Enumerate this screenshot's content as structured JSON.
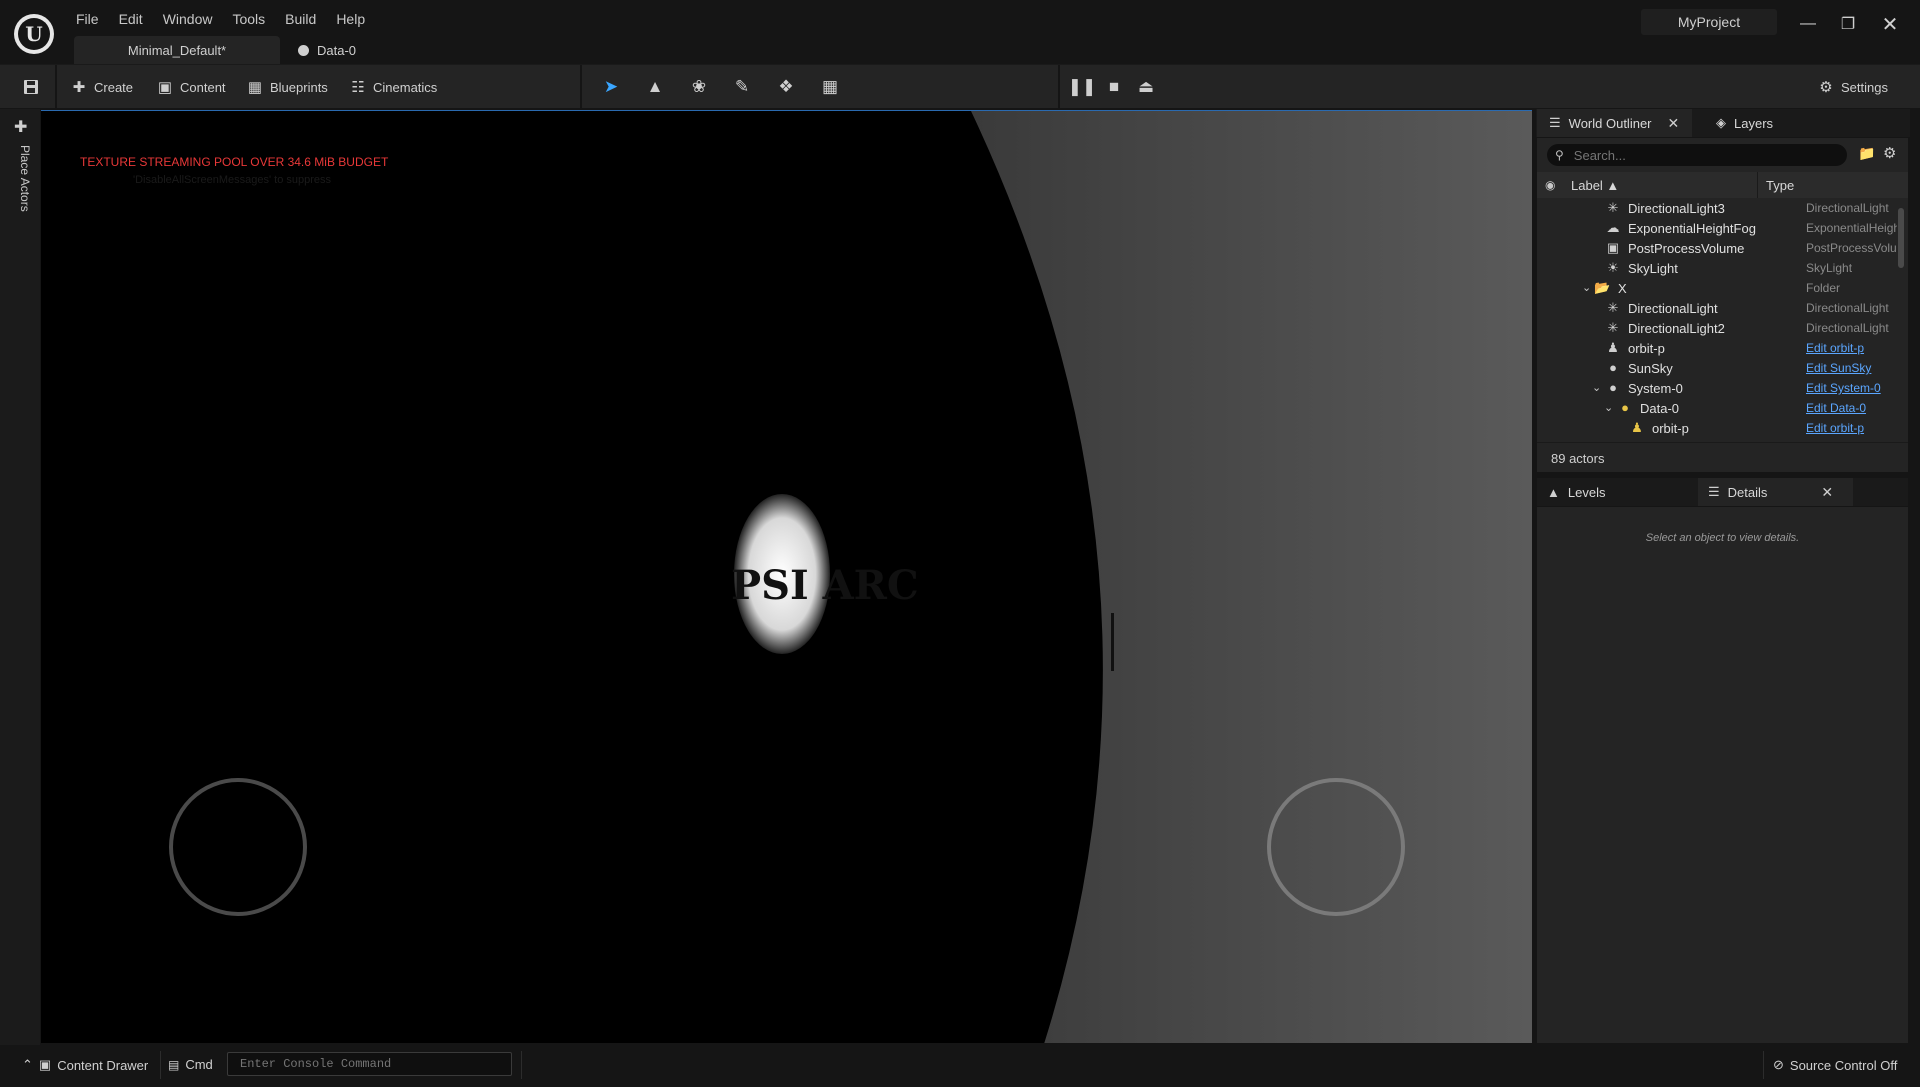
{
  "app": {
    "project_name": "MyProject",
    "menu": [
      "File",
      "Edit",
      "Window",
      "Tools",
      "Build",
      "Help"
    ],
    "tabs": [
      {
        "label": "Minimal_Default*"
      },
      {
        "label": "Data-0"
      }
    ]
  },
  "toolbar": {
    "create_label": "Create",
    "content_label": "Content",
    "blueprints_label": "Blueprints",
    "cinematics_label": "Cinematics",
    "settings_label": "Settings",
    "mode_icons": [
      "select-mode-icon",
      "landscape-mode-icon",
      "foliage-mode-icon",
      "mesh-paint-mode-icon",
      "fracture-mode-icon",
      "modeling-mode-icon"
    ],
    "play_icons": [
      "pause-icon",
      "stop-icon",
      "eject-icon"
    ],
    "accent_color": "#3aa6ff"
  },
  "left_rail": {
    "place_actors_label": "Place Actors"
  },
  "viewport": {
    "warning_text": "TEXTURE STREAMING POOL OVER 34.6 MiB BUDGET",
    "warning_subtext": "'DisableAllScreenMessages' to suppress",
    "warning_color": "#e83838",
    "logo_text": "PSI ARC"
  },
  "world_outliner": {
    "tab_label": "World Outliner",
    "layers_tab_label": "Layers",
    "search_placeholder": "Search...",
    "col_label": "Label",
    "col_type": "Type",
    "rows": [
      {
        "label": "DirectionalLight3",
        "type": "DirectionalLight",
        "icon": "directional-light-icon",
        "link": false
      },
      {
        "label": "ExponentialHeightFog",
        "type": "ExponentialHeightFog",
        "icon": "height-fog-icon",
        "link": false
      },
      {
        "label": "PostProcessVolume",
        "type": "PostProcessVolume",
        "icon": "post-process-volume-icon",
        "link": false
      },
      {
        "label": "SkyLight",
        "type": "SkyLight",
        "icon": "sky-light-icon",
        "link": false
      },
      {
        "label": "X",
        "type": "Folder",
        "icon": "folder-open-icon",
        "link": false
      },
      {
        "label": "DirectionalLight",
        "type": "DirectionalLight",
        "icon": "directional-light-icon",
        "link": false
      },
      {
        "label": "DirectionalLight2",
        "type": "DirectionalLight",
        "icon": "directional-light-icon",
        "link": false
      },
      {
        "label": "orbit-p",
        "type": "Edit orbit-p",
        "icon": "pawn-icon",
        "link": true
      },
      {
        "label": "SunSky",
        "type": "Edit SunSky",
        "icon": "sphere-icon",
        "link": true
      },
      {
        "label": "System-0",
        "type": "Edit System-0",
        "icon": "sphere-icon",
        "link": true
      },
      {
        "label": "Data-0",
        "type": "Edit Data-0",
        "icon": "sphere-icon",
        "link": true
      },
      {
        "label": "orbit-p",
        "type": "Edit orbit-p",
        "icon": "pawn-icon",
        "link": true
      }
    ],
    "actor_count": "89 actors"
  },
  "details": {
    "levels_tab_label": "Levels",
    "details_tab_label": "Details",
    "empty_message": "Select an object to view details."
  },
  "statusbar": {
    "content_drawer_label": "Content Drawer",
    "cmd_label": "Cmd",
    "console_placeholder": "Enter Console Command",
    "source_control_label": "Source Control Off"
  }
}
